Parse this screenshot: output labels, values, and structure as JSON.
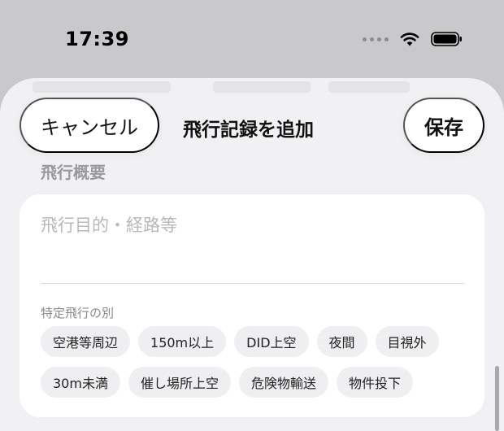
{
  "status_bar": {
    "time": "17:39",
    "icons": [
      "signal-dots-icon",
      "wifi-icon",
      "battery-icon"
    ]
  },
  "nav": {
    "cancel_label": "キャンセル",
    "title": "飛行記録を追加",
    "save_label": "保存"
  },
  "section": {
    "title": "飛行概要"
  },
  "form": {
    "purpose_placeholder": "飛行目的・経路等",
    "purpose_value": "",
    "specific_flight_label": "特定飛行の別",
    "chips_row1": [
      "空港等周辺",
      "150m以上",
      "DID上空",
      "夜間",
      "目視外"
    ],
    "chips_row2": [
      "30m未満",
      "催し場所上空",
      "危険物輸送",
      "物件投下"
    ]
  },
  "colors": {
    "background": "#c9c9cc",
    "sheet": "#f1f1f4",
    "card": "#ffffff",
    "chip": "#efeff2",
    "placeholder": "#b8b8bc",
    "section_title": "#9a9a9e"
  }
}
